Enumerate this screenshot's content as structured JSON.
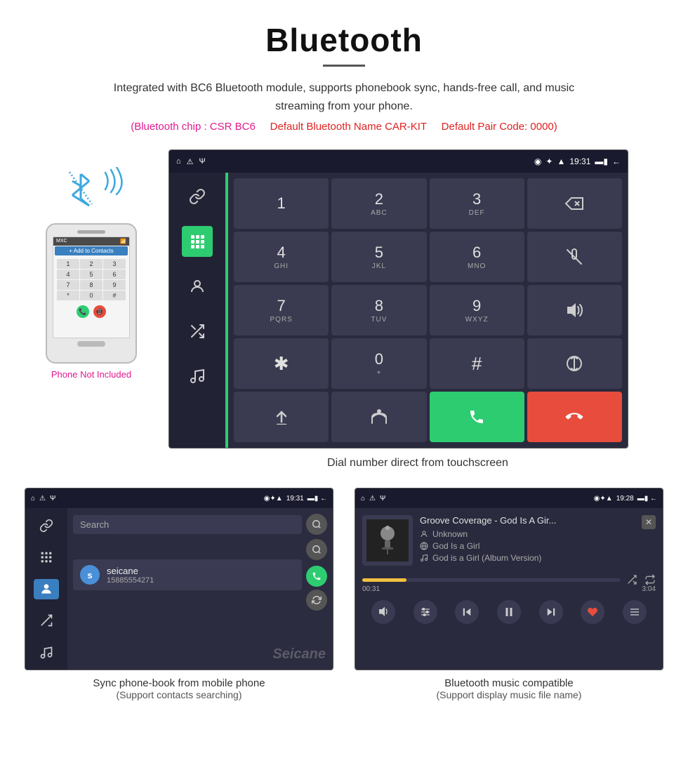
{
  "header": {
    "title": "Bluetooth",
    "desc": "Integrated with BC6 Bluetooth module, supports phonebook sync, hands-free call, and music streaming from your phone.",
    "spec1_label": "(Bluetooth chip : CSR BC6",
    "spec2_label": "Default Bluetooth Name CAR-KIT",
    "spec3_label": "Default Pair Code: 0000)",
    "underline_color": "#555"
  },
  "phone_col": {
    "not_included_label": "Phone Not Included"
  },
  "dial_screen": {
    "status_time": "19:31",
    "keys": [
      {
        "main": "1",
        "sub": ""
      },
      {
        "main": "2",
        "sub": "ABC"
      },
      {
        "main": "3",
        "sub": "DEF"
      },
      {
        "main": "⌫",
        "sub": ""
      },
      {
        "main": "4",
        "sub": "GHI"
      },
      {
        "main": "5",
        "sub": "JKL"
      },
      {
        "main": "6",
        "sub": "MNO"
      },
      {
        "main": "🎤",
        "sub": ""
      },
      {
        "main": "7",
        "sub": "PQRS"
      },
      {
        "main": "8",
        "sub": "TUV"
      },
      {
        "main": "9",
        "sub": "WXYZ"
      },
      {
        "main": "🔊",
        "sub": ""
      },
      {
        "main": "✱",
        "sub": ""
      },
      {
        "main": "0",
        "sub": "+"
      },
      {
        "main": "#",
        "sub": ""
      },
      {
        "main": "⇅",
        "sub": ""
      },
      {
        "main": "⬆",
        "sub": ""
      },
      {
        "main": "⇄",
        "sub": ""
      },
      {
        "main": "📞",
        "sub": ""
      },
      {
        "main": "📵",
        "sub": ""
      }
    ],
    "caption": "Dial number direct from touchscreen"
  },
  "phonebook": {
    "status_time": "19:31",
    "search_placeholder": "Search",
    "contact_initial": "s",
    "contact_name": "seicane",
    "contact_phone": "15885554271",
    "caption_title": "Sync phone-book from mobile phone",
    "caption_sub": "(Support contacts searching)"
  },
  "music": {
    "status_time": "19:28",
    "song_title": "Groove Coverage - God Is A Gir...",
    "artist": "Unknown",
    "album": "God Is a Girl",
    "track": "God is a Girl (Album Version)",
    "progress_current": "00:31",
    "progress_total": "3:04",
    "progress_percent": 17,
    "caption_title": "Bluetooth music compatible",
    "caption_sub": "(Support display music file name)"
  },
  "icons": {
    "bluetooth_unicode": "⬡",
    "home": "⌂",
    "back": "←",
    "warning": "⚠",
    "usb": "Ψ",
    "location": "◉",
    "wifi": "▲",
    "battery": "▬",
    "search": "🔍",
    "call_green": "📞",
    "call_red": "📵",
    "shuffle": "⇄",
    "repeat": "↺",
    "prev": "⏮",
    "play": "⏸",
    "next": "⏭",
    "love": "♥",
    "list": "≡",
    "volume": "🔊",
    "chain": "🔗",
    "dialpad": "⌨",
    "person": "👤",
    "transfer": "↗",
    "note": "♪",
    "close": "✕"
  }
}
